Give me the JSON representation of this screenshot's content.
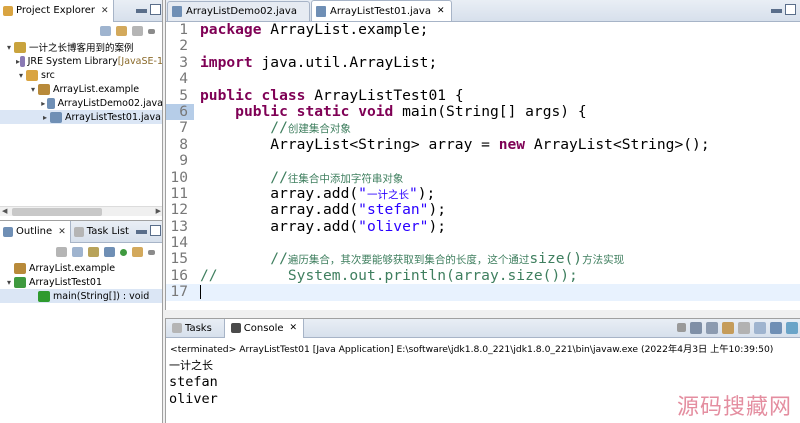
{
  "project_explorer": {
    "tabs": [
      {
        "label": "Project Explorer",
        "close": "✕"
      }
    ],
    "tree": [
      {
        "label": "一计之长博客用到的案例",
        "expander": "▾",
        "icon": "project-folder-icon",
        "indent": 0
      },
      {
        "label": "JRE System Library",
        "suffix": " [JavaSE-1",
        "expander": "▸",
        "icon": "library-icon",
        "indent": 1
      },
      {
        "label": "src",
        "expander": "▾",
        "icon": "source-folder-icon",
        "indent": 1
      },
      {
        "label": "ArrayList.example",
        "expander": "▾",
        "icon": "package-icon",
        "indent": 2
      },
      {
        "label": "ArrayListDemo02.java",
        "expander": "▸",
        "icon": "java-file-icon",
        "indent": 3
      },
      {
        "label": "ArrayListTest01.java",
        "expander": "▸",
        "icon": "java-file-icon",
        "indent": 3,
        "selected": true
      }
    ]
  },
  "outline": {
    "tabs": [
      {
        "label": "Outline",
        "close": "✕"
      },
      {
        "label": "Task List",
        "close": ""
      }
    ],
    "tree": [
      {
        "label": "ArrayList.example",
        "icon": "package-icon",
        "indent": 0
      },
      {
        "label": "ArrayListTest01",
        "expander": "▾",
        "icon": "class-icon",
        "indent": 0
      },
      {
        "label": "main(String[]) : void",
        "icon": "method-icon",
        "indent": 2,
        "selected": true
      }
    ]
  },
  "editor": {
    "tabs": [
      {
        "label": "ArrayListDemo02.java",
        "active": false,
        "close": ""
      },
      {
        "label": "ArrayListTest01.java",
        "active": true,
        "close": "✕"
      }
    ],
    "lines": [
      {
        "n": "1",
        "parts": [
          {
            "t": "package",
            "c": "kw"
          },
          {
            "t": " ArrayList.example;"
          }
        ]
      },
      {
        "n": "2",
        "parts": []
      },
      {
        "n": "3",
        "parts": [
          {
            "t": "import",
            "c": "kw"
          },
          {
            "t": " java.util.ArrayList;"
          }
        ]
      },
      {
        "n": "4",
        "parts": []
      },
      {
        "n": "5",
        "parts": [
          {
            "t": "public",
            "c": "kw"
          },
          {
            "t": " "
          },
          {
            "t": "class",
            "c": "kw"
          },
          {
            "t": " ArrayListTest01 {"
          }
        ]
      },
      {
        "n": "6",
        "mark": true,
        "parts": [
          {
            "t": "    "
          },
          {
            "t": "public",
            "c": "kw"
          },
          {
            "t": " "
          },
          {
            "t": "static",
            "c": "kw"
          },
          {
            "t": " "
          },
          {
            "t": "void",
            "c": "kw"
          },
          {
            "t": " main(String[] args) {"
          }
        ]
      },
      {
        "n": "7",
        "parts": [
          {
            "t": "        "
          },
          {
            "t": "//",
            "c": "cmt"
          },
          {
            "t": "创建集合对象",
            "c": "cmt cjk"
          }
        ]
      },
      {
        "n": "8",
        "parts": [
          {
            "t": "        ArrayList<String> array = "
          },
          {
            "t": "new",
            "c": "kw"
          },
          {
            "t": " ArrayList<String>();"
          }
        ]
      },
      {
        "n": "9",
        "parts": []
      },
      {
        "n": "10",
        "parts": [
          {
            "t": "        "
          },
          {
            "t": "//",
            "c": "cmt"
          },
          {
            "t": "往集合中添加字符串对象",
            "c": "cmt cjk"
          }
        ]
      },
      {
        "n": "11",
        "parts": [
          {
            "t": "        array.add("
          },
          {
            "t": "\"",
            "c": "str"
          },
          {
            "t": "一计之长",
            "c": "str cjk"
          },
          {
            "t": "\"",
            "c": "str"
          },
          {
            "t": ");"
          }
        ]
      },
      {
        "n": "12",
        "parts": [
          {
            "t": "        array.add("
          },
          {
            "t": "\"stefan\"",
            "c": "str"
          },
          {
            "t": ");"
          }
        ]
      },
      {
        "n": "13",
        "parts": [
          {
            "t": "        array.add("
          },
          {
            "t": "\"oliver\"",
            "c": "str"
          },
          {
            "t": ");"
          }
        ]
      },
      {
        "n": "14",
        "parts": []
      },
      {
        "n": "15",
        "parts": [
          {
            "t": "        "
          },
          {
            "t": "//",
            "c": "cmt"
          },
          {
            "t": "遍历集合，其次要能够获取到集合的长度，这个通过",
            "c": "cmt cjk"
          },
          {
            "t": "size()",
            "c": "cmt"
          },
          {
            "t": "方法实现",
            "c": "cmt cjk"
          }
        ]
      },
      {
        "n": "16",
        "parts": [
          {
            "t": "//",
            "c": "cmt"
          },
          {
            "t": "        System.out.println(array.size());",
            "c": "cmt"
          }
        ]
      },
      {
        "n": "17",
        "cur": true,
        "parts": []
      }
    ]
  },
  "console": {
    "tabs": [
      {
        "label": "Tasks",
        "active": false,
        "close": ""
      },
      {
        "label": "Console",
        "active": true,
        "close": "✕"
      }
    ],
    "terminated_line": "<terminated> ArrayListTest01 [Java Application] E:\\software\\jdk1.8.0_221\\jdk1.8.0_221\\bin\\javaw.exe (2022年4月3日 上午10:39:50)",
    "output": [
      "一计之长",
      "stefan",
      "oliver"
    ]
  },
  "watermark": "源码搜藏网",
  "colors": {
    "keyword": "#7f0055",
    "string": "#2a00ff",
    "comment": "#3f7f5f",
    "current_line": "#e8f2fe",
    "watermark": "#e07b90"
  },
  "icons": {
    "project-folder-icon": "#c9a33d",
    "library-icon": "#8a7ab5",
    "source-folder-icon": "#d9a441",
    "package-icon": "#b88a3a",
    "java-file-icon": "#6f8fb5",
    "class-icon": "#3f9a3f",
    "method-icon": "#2e9a2e"
  }
}
